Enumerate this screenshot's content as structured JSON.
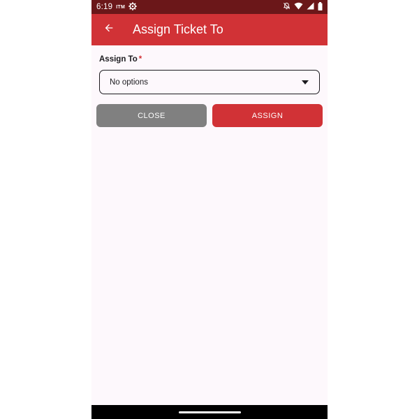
{
  "status_bar": {
    "time": "6:19",
    "carrier_badge": "ITM",
    "icons": [
      "settings-icon",
      "alarm-off-icon",
      "wifi-icon",
      "signal-icon",
      "battery-icon"
    ]
  },
  "app_bar": {
    "title": "Assign Ticket To",
    "back_icon": "arrow-back-icon",
    "color": "#d13236"
  },
  "form": {
    "assign_to_label": "Assign To",
    "required_mark": "*",
    "select_value": "No options",
    "dropdown_icon": "dropdown-arrow-icon"
  },
  "buttons": {
    "close_label": "CLOSE",
    "assign_label": "ASSIGN",
    "close_color": "#808080",
    "assign_color": "#d13236"
  },
  "colors": {
    "status_bar": "#6b1719",
    "background": "#fdf8fc",
    "nav_bar": "#000000"
  }
}
